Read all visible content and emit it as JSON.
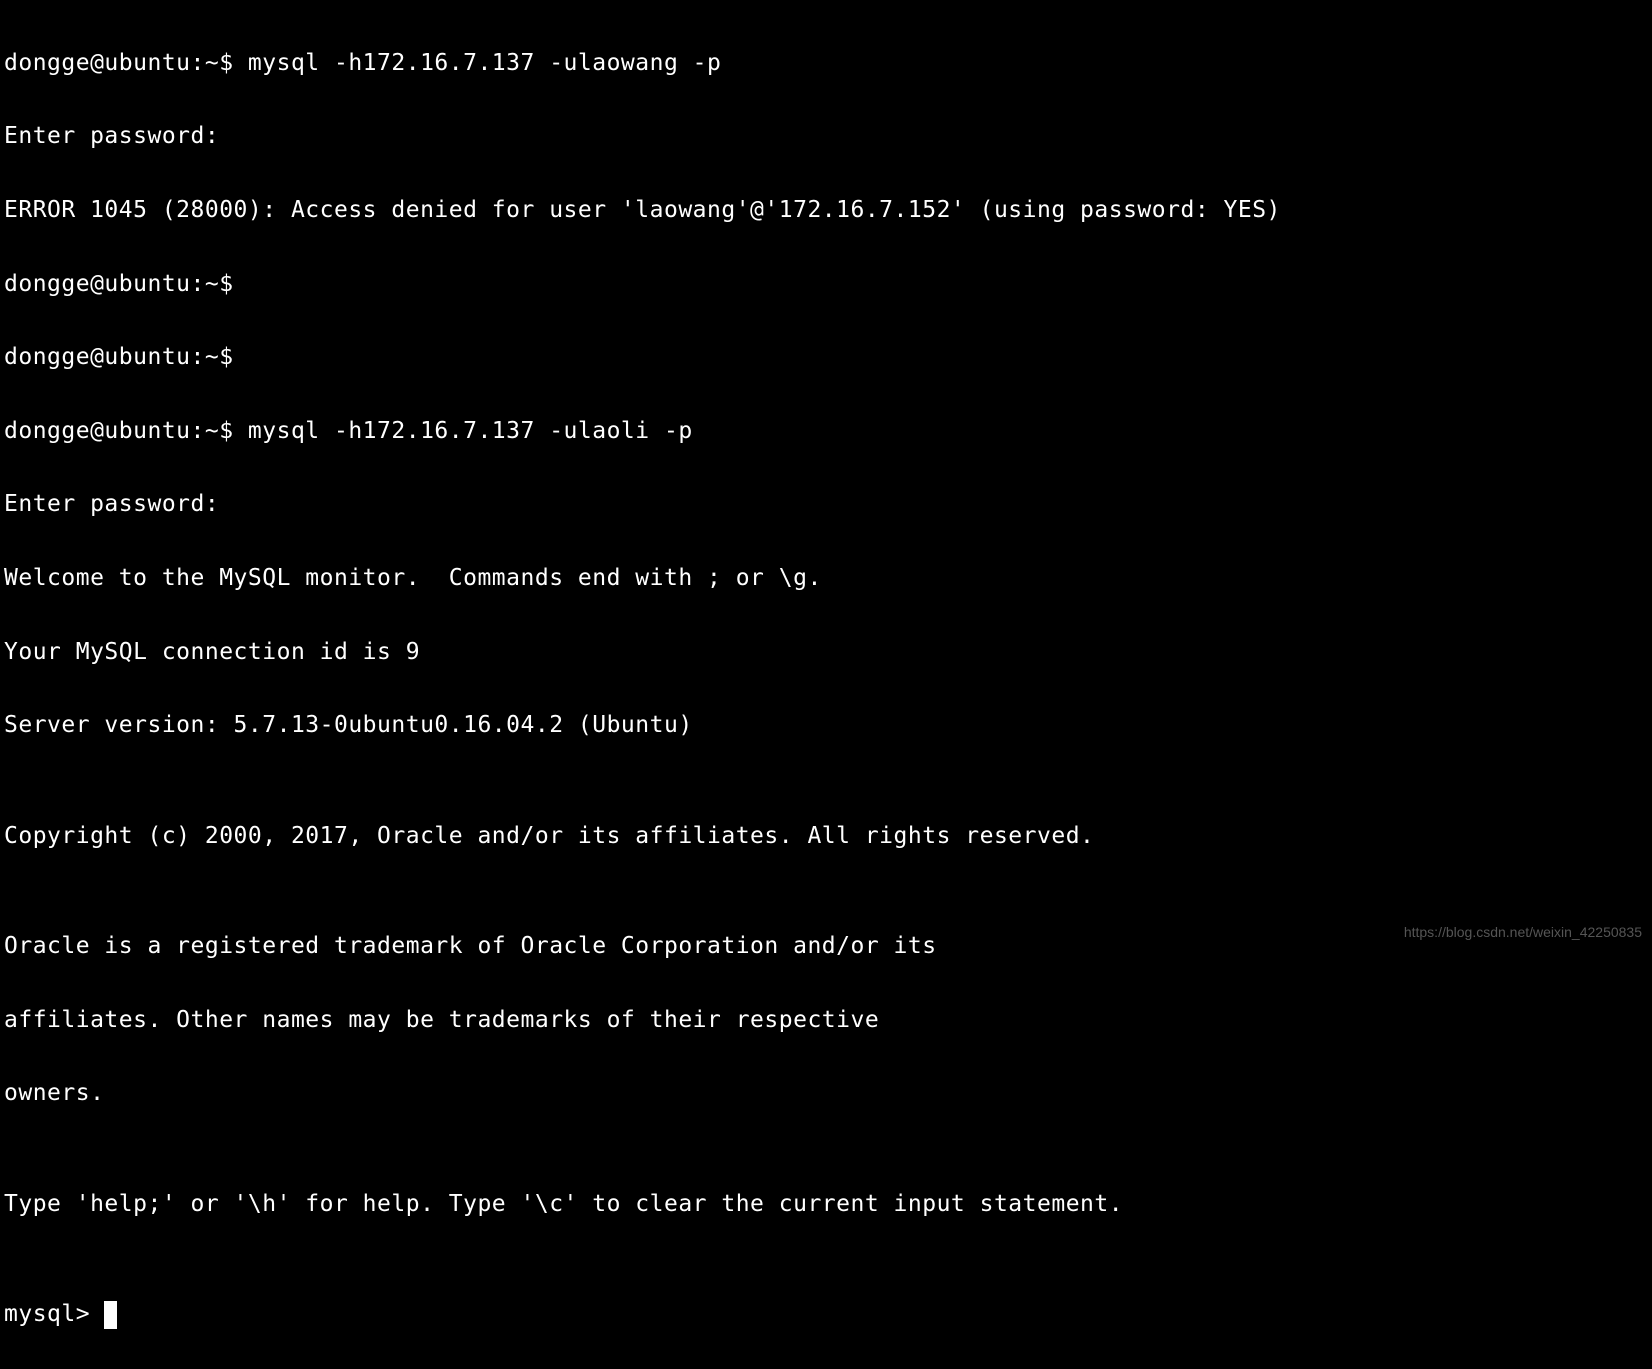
{
  "terminal": {
    "lines": [
      "dongge@ubuntu:~$ mysql -h172.16.7.137 -ulaowang -p",
      "Enter password:",
      "ERROR 1045 (28000): Access denied for user 'laowang'@'172.16.7.152' (using password: YES)",
      "dongge@ubuntu:~$",
      "dongge@ubuntu:~$",
      "dongge@ubuntu:~$ mysql -h172.16.7.137 -ulaoli -p",
      "Enter password:",
      "Welcome to the MySQL monitor.  Commands end with ; or \\g.",
      "Your MySQL connection id is 9",
      "Server version: 5.7.13-0ubuntu0.16.04.2 (Ubuntu)",
      "",
      "Copyright (c) 2000, 2017, Oracle and/or its affiliates. All rights reserved.",
      "",
      "Oracle is a registered trademark of Oracle Corporation and/or its",
      "affiliates. Other names may be trademarks of their respective",
      "owners.",
      "",
      "Type 'help;' or '\\h' for help. Type '\\c' to clear the current input statement.",
      ""
    ],
    "current_prompt": "mysql> "
  },
  "watermark": "https://blog.csdn.net/weixin_42250835"
}
